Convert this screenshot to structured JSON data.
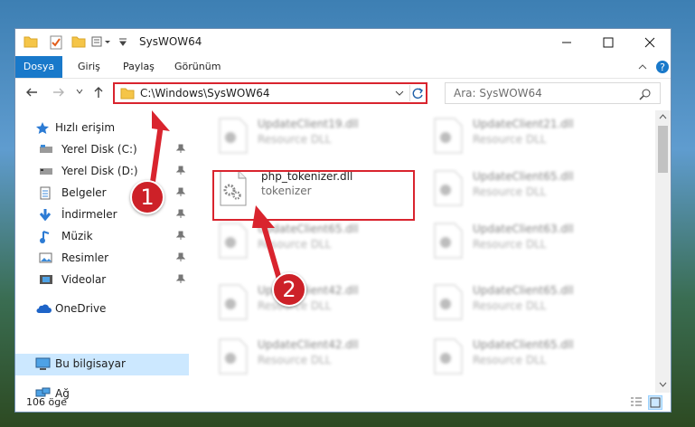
{
  "window": {
    "title": "SysWOW64"
  },
  "ribbon": {
    "tabs": [
      "Dosya",
      "Giriş",
      "Paylaş",
      "Görünüm"
    ]
  },
  "address": {
    "path": "C:\\Windows\\SysWOW64"
  },
  "search": {
    "placeholder": "Ara: SysWOW64"
  },
  "sidebar": {
    "items": [
      {
        "label": "Hızlı erişim"
      },
      {
        "label": "Yerel Disk (C:)"
      },
      {
        "label": "Yerel Disk (D:)"
      },
      {
        "label": "Belgeler"
      },
      {
        "label": "İndirmeler"
      },
      {
        "label": "Müzik"
      },
      {
        "label": "Resimler"
      },
      {
        "label": "Videolar"
      },
      {
        "label": "OneDrive"
      },
      {
        "label": "Bu bilgisayar"
      },
      {
        "label": "Ağ"
      }
    ]
  },
  "files": {
    "highlighted": {
      "name": "php_tokenizer.dll",
      "description": "tokenizer"
    },
    "others": [
      {
        "name": "UpdateClient19.dll",
        "description": "Resource DLL"
      },
      {
        "name": "UpdateClient21.dll",
        "description": "Resource DLL"
      },
      {
        "name": "UpdateClient65.dll",
        "description": "Resource DLL"
      },
      {
        "name": "UpdateClient65.dll",
        "description": "Resource DLL"
      },
      {
        "name": "UpdateClient63.dll",
        "description": "Resource DLL"
      },
      {
        "name": "UpdateClient42.dll",
        "description": "Resource DLL"
      },
      {
        "name": "UpdateClient65.dll",
        "description": "Resource DLL"
      },
      {
        "name": "UpdateClient42.dll",
        "description": "Resource DLL"
      },
      {
        "name": "UpdateClient65.dll",
        "description": "Resource DLL"
      }
    ]
  },
  "status": {
    "count": "106 öge"
  },
  "annotations": {
    "step1": "1",
    "step2": "2"
  },
  "colors": {
    "accent": "#1979ca",
    "highlight": "#d9242e",
    "selection": "#cce8ff"
  }
}
